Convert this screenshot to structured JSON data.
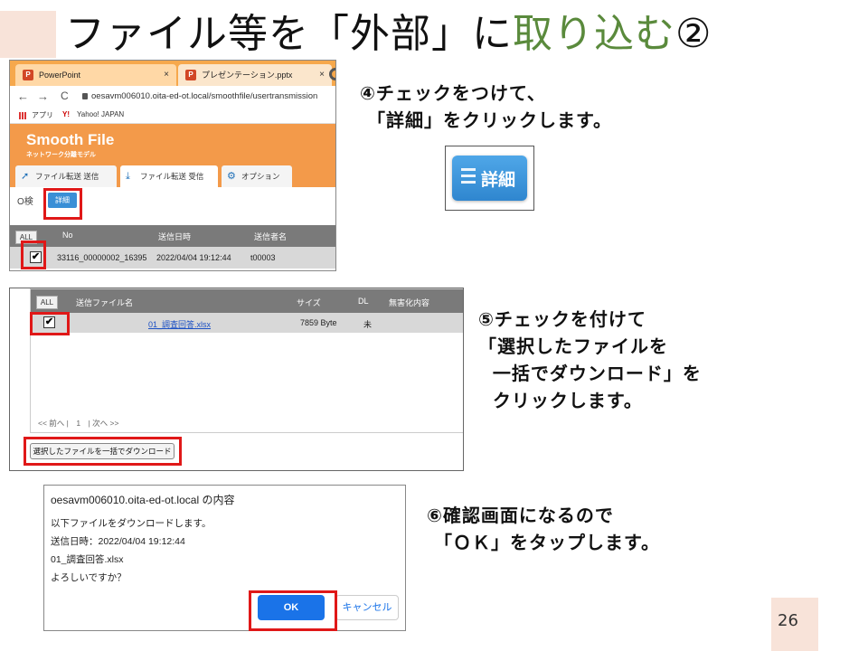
{
  "slide": {
    "title_main": "ファイル等を「外部」に",
    "title_accent": "取り込む",
    "title_suffix": "②",
    "page_number": "26"
  },
  "browser": {
    "tab1": "PowerPoint",
    "tab2": "プレゼンテーション.pptx",
    "close_glyph": "×",
    "back": "←",
    "forward": "→",
    "reload": "C",
    "url": "oesavm006010.oita-ed-ot.local/smoothfile/usertransmission",
    "bookmark_apps": "アプリ",
    "bookmark_y_mark": "Y!",
    "bookmark_yahoo": "Yahoo! JAPAN"
  },
  "app1": {
    "logo": "Smooth File",
    "subtitle": "ネットワーク分離モデル",
    "tabs": [
      "ファイル転送 送信",
      "ファイル転送 受信",
      "オプション"
    ],
    "search_label": "O検",
    "detail_label": "詳細",
    "columns": [
      "ALL",
      "No",
      "送信日時",
      "送信者名"
    ],
    "row": {
      "checked": "✔",
      "no": "33116_00000002_16395",
      "datetime": "2022/04/04 19:12:44",
      "sender": "t00003"
    }
  },
  "notes": {
    "step4": "④チェックをつけて、\n 「詳細」をクリックします。",
    "step5": "⑤チェックを付けて\n「選択したファイルを\n  一括でダウンロード」を\n  クリックします。",
    "step6": "⑥確認画面になるので\n 「ＯＫ」をタップします。"
  },
  "detail_button": {
    "label": "詳細"
  },
  "app2": {
    "columns": [
      "ALL",
      "送信ファイル名",
      "サイズ",
      "DL",
      "無害化内容"
    ],
    "row": {
      "checked": "✔",
      "filename": "01_調査回答.xlsx",
      "size": "7859 Byte",
      "dl": "未"
    },
    "pager": "<< 前へ |　1　| 次へ >>",
    "download_button": "選択したファイルを一括でダウンロード"
  },
  "dialog": {
    "title": "oesavm006010.oita-ed-ot.local の内容",
    "lines": [
      "以下ファイルをダウンロードします。",
      "送信日時：2022/04/04 19:12:44",
      "01_調査回答.xlsx",
      "よろしいですか？"
    ],
    "ok": "OK",
    "cancel": "キャンセル"
  },
  "colors": {
    "accent_green": "#5a8a3c",
    "highlight_red": "#e01818",
    "smoothfile_orange": "#f39a4a",
    "ok_blue": "#1a73e8"
  }
}
